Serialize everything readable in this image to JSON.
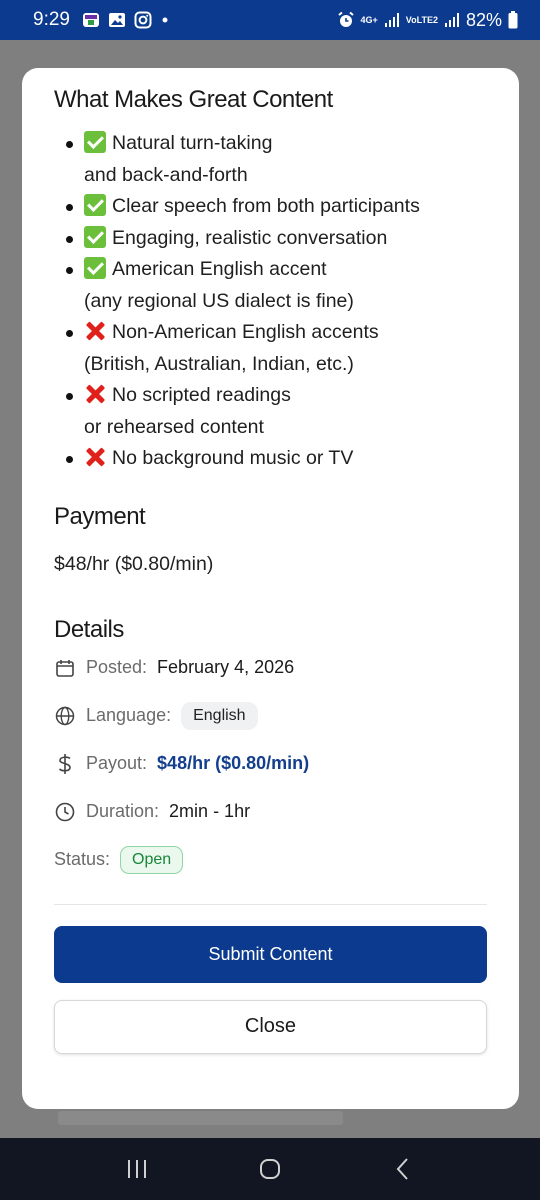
{
  "status_bar": {
    "time": "9:29",
    "network_label": "4G+",
    "volte_label": "VoLTE2",
    "battery": "82%"
  },
  "modal": {
    "content_title": "What Makes Great Content",
    "items": [
      {
        "type": "check",
        "line1": "Natural turn-taking",
        "line2": "and back-and-forth"
      },
      {
        "type": "check",
        "line1": "Clear speech from both participants",
        "line2": ""
      },
      {
        "type": "check",
        "line1": "Engaging, realistic conversation",
        "line2": ""
      },
      {
        "type": "check",
        "line1": "American English accent",
        "line2": "(any regional US dialect is fine)"
      },
      {
        "type": "cross",
        "line1": "Non-American English accents",
        "line2": "(British, Australian, Indian, etc.)"
      },
      {
        "type": "cross",
        "line1": "No scripted readings",
        "line2": "or rehearsed content"
      },
      {
        "type": "cross",
        "line1": "No background music or TV",
        "line2": ""
      }
    ],
    "payment_title": "Payment",
    "payment_value": "$48/hr ($0.80/min)",
    "details_title": "Details",
    "details": {
      "posted_label": "Posted:",
      "posted_value": "February 4, 2026",
      "language_label": "Language:",
      "language_value": "English",
      "payout_label": "Payout:",
      "payout_value": "$48/hr ($0.80/min)",
      "duration_label": "Duration:",
      "duration_value": "2min - 1hr",
      "status_label": "Status:",
      "status_value": "Open"
    },
    "submit_label": "Submit Content",
    "close_label": "Close"
  },
  "colors": {
    "brand": "#0b3a8e",
    "check": "#6cbf3b",
    "cross": "#e0201b",
    "open": "#18873a"
  }
}
